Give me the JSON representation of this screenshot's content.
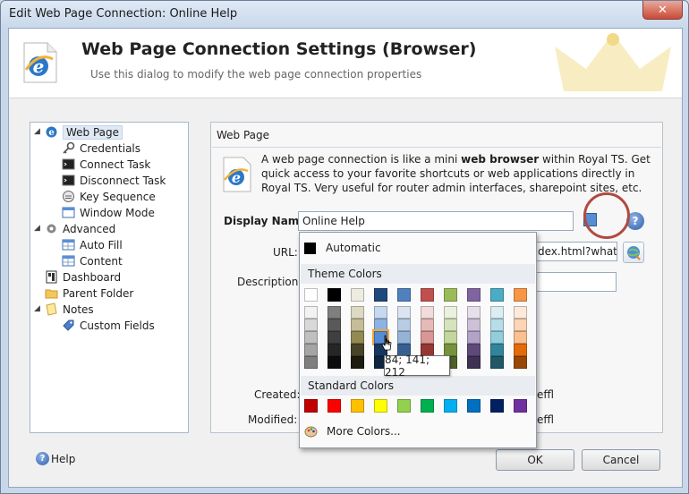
{
  "window": {
    "title": "Edit Web Page Connection: Online Help",
    "close_label": "✕"
  },
  "header": {
    "title": "Web Page Connection Settings (Browser)",
    "subtitle": "Use this dialog to modify the web page connection properties"
  },
  "tree": {
    "items": [
      {
        "label": "Web Page",
        "icon": "ie-icon"
      },
      {
        "label": "Credentials",
        "icon": "key-icon"
      },
      {
        "label": "Connect Task",
        "icon": "terminal-icon"
      },
      {
        "label": "Disconnect Task",
        "icon": "terminal-icon"
      },
      {
        "label": "Key Sequence",
        "icon": "keyboard-icon"
      },
      {
        "label": "Window Mode",
        "icon": "window-icon"
      },
      {
        "label": "Advanced",
        "icon": "gear-icon"
      },
      {
        "label": "Auto Fill",
        "icon": "table-icon"
      },
      {
        "label": "Content",
        "icon": "table-icon"
      },
      {
        "label": "Dashboard",
        "icon": "dashboard-icon"
      },
      {
        "label": "Parent Folder",
        "icon": "folder-icon"
      },
      {
        "label": "Notes",
        "icon": "notes-icon"
      },
      {
        "label": "Custom Fields",
        "icon": "tag-icon"
      }
    ]
  },
  "section": {
    "title": "Web Page",
    "info_pre": "A web page connection is like a mini ",
    "info_bold": "web browser",
    "info_post": " within Royal TS. Get quick access to your favorite shortcuts or web applications directly in Royal TS. Very useful for router admin interfaces, sharepoint sites, etc."
  },
  "form": {
    "display_name_label": "Display Name:",
    "display_name_value": "Online Help",
    "url_label": "URL:",
    "url_value": "dex.html?what",
    "description_label": "Description:",
    "description_value": "",
    "created_label": "Created:",
    "created_value": "effl",
    "modified_label": "Modified:",
    "modified_value": "effl"
  },
  "color_picker": {
    "selected_color": "#548dd4",
    "automatic_label": "Automatic",
    "theme_colors_label": "Theme Colors",
    "standard_colors_label": "Standard Colors",
    "more_colors_label": "More Colors...",
    "tooltip": "84; 141; 212",
    "theme_top": [
      "#ffffff",
      "#000000",
      "#eeece1",
      "#1f497d",
      "#4f81bd",
      "#c0504d",
      "#9bbb59",
      "#8064a2",
      "#4bacc6",
      "#f79646"
    ],
    "theme_shades": [
      [
        "#f2f2f2",
        "#7f7f7f",
        "#ddd9c3",
        "#c6d9f0",
        "#dbe5f1",
        "#f2dcdb",
        "#ebf1dd",
        "#e5e0ec",
        "#dbeef3",
        "#fdeada"
      ],
      [
        "#d8d8d8",
        "#595959",
        "#c4bd97",
        "#8db3e2",
        "#b8cce4",
        "#e5b9b7",
        "#d7e3bc",
        "#ccc1d9",
        "#b7dde8",
        "#fbd5b5"
      ],
      [
        "#bfbfbf",
        "#3f3f3f",
        "#938953",
        "#548dd4",
        "#95b3d7",
        "#d99694",
        "#c3d69b",
        "#b2a2c7",
        "#92cddc",
        "#fac08f"
      ],
      [
        "#a5a5a5",
        "#262626",
        "#494429",
        "#17365d",
        "#366092",
        "#953734",
        "#76923c",
        "#5f497a",
        "#31859b",
        "#e36c09"
      ],
      [
        "#7f7f7f",
        "#0c0c0c",
        "#1d1b10",
        "#0f243e",
        "#244061",
        "#632423",
        "#4f6128",
        "#3f3151",
        "#205867",
        "#974806"
      ]
    ],
    "standard": [
      "#c00000",
      "#ff0000",
      "#ffc000",
      "#ffff00",
      "#92d050",
      "#00b050",
      "#00b0f0",
      "#0070c0",
      "#002060",
      "#7030a0"
    ]
  },
  "buttons": {
    "ok": "OK",
    "cancel": "Cancel",
    "help": "Help",
    "help_glyph": "?",
    "small_help_glyph": "?"
  }
}
